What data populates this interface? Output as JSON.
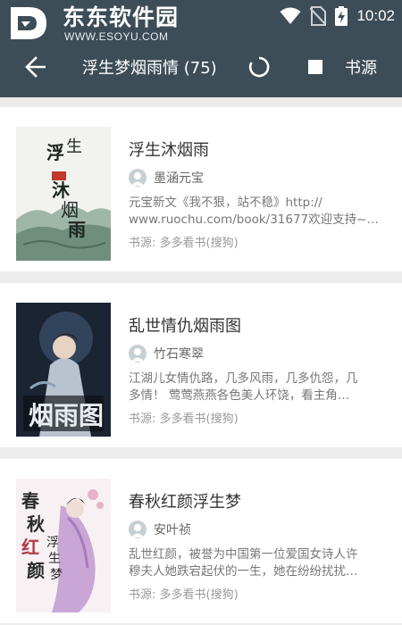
{
  "watermark": {
    "title": "东东软件园",
    "url": "WWW.ESOYU.COM"
  },
  "status_bar": {
    "time": "10:02",
    "icons": [
      "wifi-icon",
      "no-sim-icon",
      "battery-charging-icon"
    ]
  },
  "toolbar": {
    "title": "浮生梦烟雨情 (75)",
    "source_label": "书源",
    "icons": [
      "back-arrow-icon",
      "refresh-icon",
      "stop-icon"
    ]
  },
  "colors": {
    "appbar": "#3d4d57",
    "background": "#ececec",
    "card": "#ffffff"
  },
  "results": [
    {
      "title": "浮生沐烟雨",
      "author": "墨涵元宝",
      "desc_line1": "元宝新文《我不狠，站不稳》http://",
      "desc_line2": "www.ruochu.com/book/31677欢迎支持~…",
      "origin": "书源: 多多看书(搜狗)",
      "cover_text": "浮生沐烟雨"
    },
    {
      "title": "乱世情仇烟雨图",
      "author": "竹石寒翠",
      "desc_line1": "江湖儿女情仇路，几多风雨，几多仇怨，几",
      "desc_line2": "多情！ 莺莺燕燕各色美人环饶，看主角…",
      "origin": "书源: 多多看书(搜狗)",
      "cover_text": "烟雨图"
    },
    {
      "title": "春秋红颜浮生梦",
      "author": "安叶祯",
      "desc_line1": "乱世红颜，被誉为中国第一位爱国女诗人许",
      "desc_line2": "穆夫人她跌宕起伏的一生，她在纷纷扰扰…",
      "origin": "书源: 多多看书(搜狗)",
      "cover_text": "春秋红颜浮生梦"
    }
  ]
}
